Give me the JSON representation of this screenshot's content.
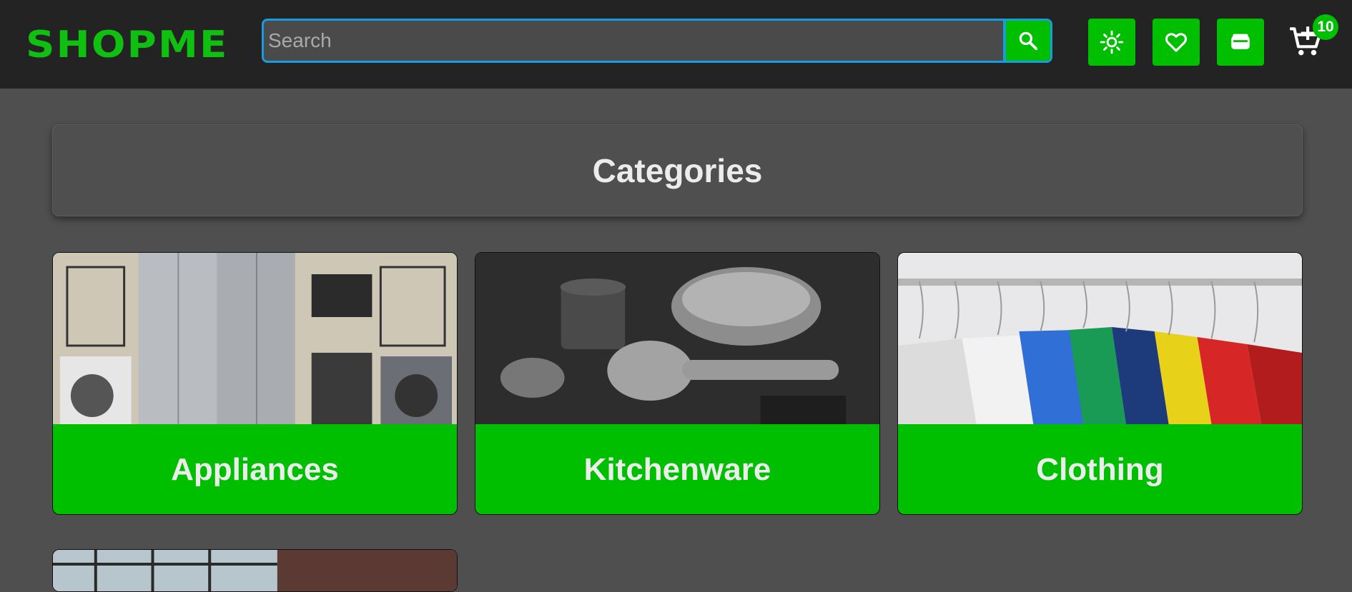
{
  "header": {
    "logo": "SHOPME",
    "search": {
      "placeholder": "Search",
      "value": "",
      "icon": "search-icon"
    },
    "buttons": [
      {
        "name": "theme-toggle-button",
        "icon": "sun-icon"
      },
      {
        "name": "wishlist-button",
        "icon": "heart-icon"
      },
      {
        "name": "wallet-button",
        "icon": "wallet-icon"
      }
    ],
    "cart": {
      "icon": "cart-icon",
      "count": "10"
    }
  },
  "main": {
    "section_title": "Categories",
    "categories": [
      {
        "label": "Appliances"
      },
      {
        "label": "Kitchenware"
      },
      {
        "label": "Clothing"
      }
    ]
  },
  "colors": {
    "accent": "#00bf00",
    "focus": "#1a9be0",
    "topbar": "#232323",
    "background": "#4f4f4f"
  }
}
